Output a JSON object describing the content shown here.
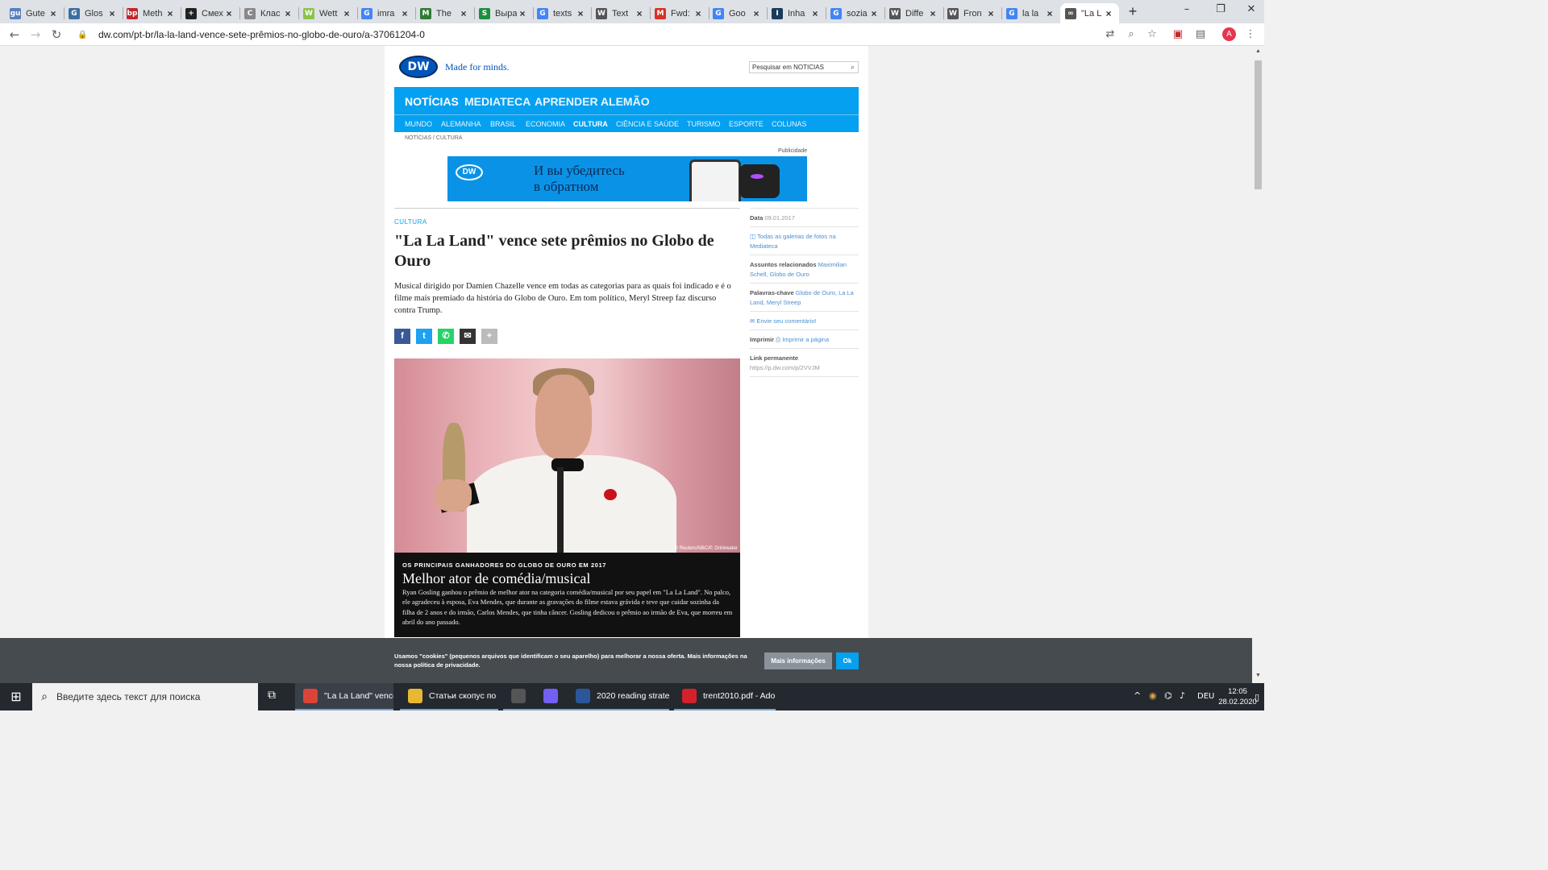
{
  "browser": {
    "tabs": [
      {
        "title": "Gute",
        "icon": "gutenberg-icon",
        "color": "#5a7fbf",
        "glyph": "gu"
      },
      {
        "title": "Glos",
        "icon": "glossary-icon",
        "color": "#3d6fa0",
        "glyph": "G"
      },
      {
        "title": "Meth",
        "icon": "bp-icon",
        "color": "#c1272d",
        "glyph": "bp"
      },
      {
        "title": "Смех",
        "icon": "plus-box-icon",
        "color": "#222222",
        "glyph": "+"
      },
      {
        "title": "Клас",
        "icon": "c-icon",
        "color": "#888888",
        "glyph": "C"
      },
      {
        "title": "Wett",
        "icon": "green-app-icon",
        "color": "#8bc34a",
        "glyph": "W"
      },
      {
        "title": "imra",
        "icon": "google-icon",
        "color": "#4285f4",
        "glyph": "G"
      },
      {
        "title": "The",
        "icon": "m-icon",
        "color": "#2e7d32",
        "glyph": "M"
      },
      {
        "title": "Выра",
        "icon": "sheet-icon",
        "color": "#1e8e3e",
        "glyph": "S"
      },
      {
        "title": "texts",
        "icon": "google-icon",
        "color": "#4285f4",
        "glyph": "G"
      },
      {
        "title": "Text",
        "icon": "wikipedia-icon",
        "color": "#555555",
        "glyph": "W"
      },
      {
        "title": "Fwd:",
        "icon": "gmail-icon",
        "color": "#d93025",
        "glyph": "M"
      },
      {
        "title": "Goo",
        "icon": "google-translate-icon",
        "color": "#4285f4",
        "glyph": "G"
      },
      {
        "title": "Inha",
        "icon": "doc-icon",
        "color": "#1a3a5c",
        "glyph": "I"
      },
      {
        "title": "sozia",
        "icon": "google-icon",
        "color": "#4285f4",
        "glyph": "G"
      },
      {
        "title": "Diffe",
        "icon": "wikipedia-icon",
        "color": "#555555",
        "glyph": "W"
      },
      {
        "title": "Fron",
        "icon": "wikipedia-icon",
        "color": "#555555",
        "glyph": "W"
      },
      {
        "title": "la la",
        "icon": "google-icon",
        "color": "#4285f4",
        "glyph": "G"
      },
      {
        "title": "\"La L",
        "icon": "link-icon",
        "color": "#555555",
        "glyph": "∞"
      }
    ],
    "new_tab": "+",
    "window_controls": {
      "minimize": "–",
      "maximize": "❐",
      "close": "✕"
    },
    "url": "dw.com/pt-br/la-la-land-vence-sete-prêmios-no-globo-de-ouro/a-37061204-0",
    "avatar_letter": "A"
  },
  "dw": {
    "logo": "DW",
    "tagline": "Made for minds.",
    "search_placeholder": "Pesquisar em NOTICIAS",
    "main_nav": [
      "NOTÍCIAS",
      "MEDIATECA",
      "APRENDER ALEMÃO"
    ],
    "sub_nav": [
      "MUNDO",
      "ALEMANHA",
      "BRASIL",
      "ECONOMIA",
      "CULTURA",
      "CIÊNCIA E SAÚDE",
      "TURISMO",
      "ESPORTE",
      "COLUNAS"
    ],
    "active_sub": "CULTURA",
    "breadcrumb": "NOTÍCIAS / CULTURA",
    "ad_label": "Publicidade",
    "ad_logo": "DW",
    "ad_line1": "И вы убедитесь",
    "ad_line2": "в обратном"
  },
  "article": {
    "kicker": "CULTURA",
    "title": "\"La La Land\" vence sete prêmios no Globo de Ouro",
    "lead": "Musical dirigido por Damien Chazelle vence em todas as categorias para as quais foi indicado e é o filme mais premiado da história do Globo de Ouro. Em tom político, Meryl Streep faz discurso contra Trump.",
    "share": [
      {
        "name": "facebook-share-button",
        "glyph": "f",
        "color": "#3b5998"
      },
      {
        "name": "twitter-share-button",
        "glyph": "t",
        "color": "#1da1f2"
      },
      {
        "name": "whatsapp-share-button",
        "glyph": "✆",
        "color": "#25d366"
      },
      {
        "name": "email-share-button",
        "glyph": "✉",
        "color": "#333333"
      },
      {
        "name": "more-share-button",
        "glyph": "+",
        "color": "#bbbbbb"
      }
    ],
    "photo_credit": "© Reuters/NBC/P. Drinkwater",
    "gallery_kicker": "OS PRINCIPAIS GANHADORES DO GLOBO DE OURO EM 2017",
    "gallery_title": "Melhor ator de comédia/musical",
    "gallery_text": "Ryan Gosling ganhou o prêmio de melhor ator na categoria comédia/musical por seu papel em \"La La Land\". No palco, ele agradeceu à esposa, Eva Mendes, que durante as gravações do filme estava grávida e teve que cuidar sozinha da filha de 2 anos e do irmão, Carlos Mendes, que tinha câncer. Gosling dedicou o prêmio ao irmão de Eva, que morreu em abril do ano passado."
  },
  "sidebar": {
    "date_label": "Data",
    "date_value": "09.01.2017",
    "gallery_link": "Todas as galerias de fotos na Mediateca",
    "related_label": "Assuntos relacionados",
    "related_links": "Maximilian Schell, Globo de Ouro",
    "keywords_label": "Palavras-chave",
    "keywords_links": "Globo de Ouro, La La Land, Meryl Streep",
    "comment_link": "Envie seu comentário!",
    "print_label": "Imprimir",
    "print_link": "Imprimir a página",
    "permalink_label": "Link permanente",
    "permalink_value": "https://p.dw.com/p/2VVJM"
  },
  "cookie": {
    "text": "Usamos \"cookies\" (pequenos arquivos que identificam o seu aparelho) para melhorar a nossa oferta. Mais informações na nossa política de privacidade.",
    "more_info": "Mais informações",
    "ok": "Ok"
  },
  "taskbar": {
    "search_placeholder": "Введите здесь текст для поиска",
    "apps": [
      {
        "label": "\"La La Land\" vence ...",
        "icon": "chrome-icon",
        "color": "#db4437"
      },
      {
        "label": "Статьи скопус по ...",
        "icon": "folder-icon",
        "color": "#e8b832"
      },
      {
        "label": "",
        "icon": "calculator-icon",
        "color": "#555555"
      },
      {
        "label": "",
        "icon": "viber-icon",
        "color": "#7360f2"
      },
      {
        "label": "2020 reading strate...",
        "icon": "word-icon",
        "color": "#2b579a"
      },
      {
        "label": "trent2010.pdf - Ado...",
        "icon": "acrobat-icon",
        "color": "#d4202a"
      }
    ],
    "language": "DEU",
    "time": "12:05",
    "date": "28.02.2020"
  },
  "colors": {
    "dw_blue": "#05a0f0",
    "dw_dark": "#0a2a5a"
  }
}
